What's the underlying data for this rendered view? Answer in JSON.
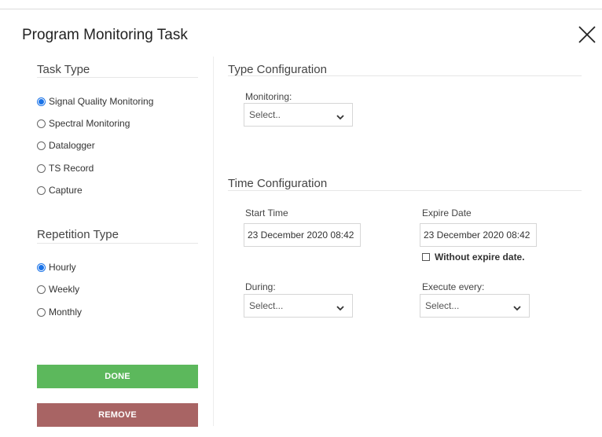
{
  "dialog": {
    "title": "Program Monitoring Task"
  },
  "task_type": {
    "heading": "Task Type",
    "options": [
      {
        "label": "Signal Quality Monitoring",
        "checked": true
      },
      {
        "label": "Spectral Monitoring",
        "checked": false
      },
      {
        "label": "Datalogger",
        "checked": false
      },
      {
        "label": "TS Record",
        "checked": false
      },
      {
        "label": "Capture",
        "checked": false
      }
    ]
  },
  "repetition_type": {
    "heading": "Repetition Type",
    "options": [
      {
        "label": "Hourly",
        "checked": true
      },
      {
        "label": "Weekly",
        "checked": false
      },
      {
        "label": "Monthly",
        "checked": false
      }
    ]
  },
  "type_configuration": {
    "heading": "Type Configuration",
    "monitoring_label": "Monitoring:",
    "monitoring_value": "Select.."
  },
  "time_configuration": {
    "heading": "Time Configuration",
    "start_time_label": "Start Time",
    "start_time_value": "23 December 2020 08:42",
    "expire_date_label": "Expire Date",
    "expire_date_value": "23 December 2020 08:42",
    "without_expire_label": "Without expire date.",
    "during_label": "During:",
    "during_value": "Select...",
    "execute_every_label": "Execute every:",
    "execute_every_value": "Select..."
  },
  "buttons": {
    "done": "DONE",
    "remove": "REMOVE"
  },
  "colors": {
    "done_bg": "#5cb85c",
    "remove_bg": "#a86464",
    "radio_accent": "#1a73e8"
  }
}
